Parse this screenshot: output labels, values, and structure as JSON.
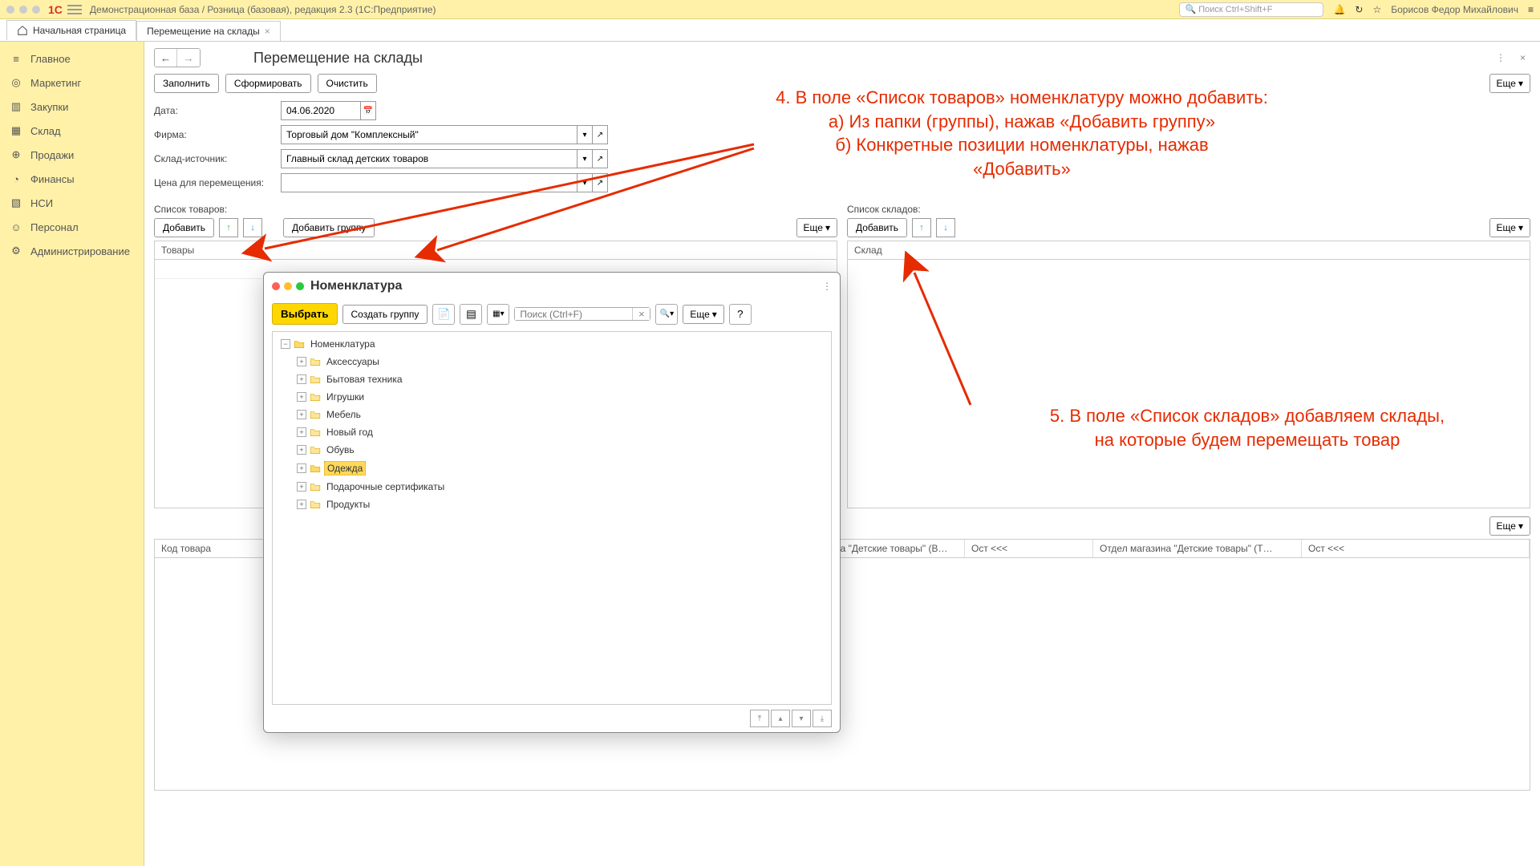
{
  "titlebar": {
    "app_title": "Демонстрационная база / Розница (базовая), редакция 2.3  (1С:Предприятие)",
    "search_placeholder": "Поиск Ctrl+Shift+F",
    "username": "Борисов Федор Михайлович"
  },
  "tabs": {
    "home": "Начальная страница",
    "active": "Перемещение на склады"
  },
  "sidebar": {
    "items": [
      {
        "label": "Главное",
        "icon": "≡"
      },
      {
        "label": "Маркетинг",
        "icon": "◎"
      },
      {
        "label": "Закупки",
        "icon": "▥"
      },
      {
        "label": "Склад",
        "icon": "▦"
      },
      {
        "label": "Продажи",
        "icon": "⊕"
      },
      {
        "label": "Финансы",
        "icon": "◔"
      },
      {
        "label": "НСИ",
        "icon": "▧"
      },
      {
        "label": "Персонал",
        "icon": "☺"
      },
      {
        "label": "Администрирование",
        "icon": "⚙"
      }
    ]
  },
  "page": {
    "title": "Перемещение на склады",
    "btn_fill": "Заполнить",
    "btn_form": "Сформировать",
    "btn_clear": "Очистить",
    "btn_more": "Еще",
    "more_caret": "▾"
  },
  "form": {
    "date_label": "Дата:",
    "date_value": "04.06.2020",
    "firm_label": "Фирма:",
    "firm_value": "Торговый дом \"Комплексный\"",
    "source_label": "Склад-источник:",
    "source_value": "Главный склад детских товаров",
    "price_label": "Цена для перемещения:",
    "price_value": ""
  },
  "goods": {
    "list_label": "Список товаров:",
    "btn_add": "Добавить",
    "btn_add_group": "Добавить группу",
    "header": "Товары"
  },
  "warehouses": {
    "list_label": "Список складов:",
    "btn_add": "Добавить",
    "header": "Склад"
  },
  "bottom": {
    "col_code": "Код товара",
    "col_ost1_prefix": "на \"Детские товары\" (В…",
    "col_ost1": "Ост <<<",
    "col_dept": "Отдел магазина \"Детские товары\" (Т…",
    "col_ost2": "Ост <<<"
  },
  "dialog": {
    "title": "Номенклатура",
    "btn_select": "Выбрать",
    "btn_create_group": "Создать группу",
    "search_placeholder": "Поиск (Ctrl+F)",
    "btn_more": "Еще",
    "btn_help": "?",
    "tree": {
      "root": "Номенклатура",
      "children": [
        "Аксессуары",
        "Бытовая техника",
        "Игрушки",
        "Мебель",
        "Новый год",
        "Обувь",
        "Одежда",
        "Подарочные сертификаты",
        "Продукты"
      ],
      "selected_index": 6
    }
  },
  "annotations": {
    "note4_line1": "4. В поле «Список товаров» номенклатуру можно добавить:",
    "note4_line2": "а) Из папки (группы), нажав «Добавить группу»",
    "note4_line3": "б) Конкретные позиции номенклатуры, нажав",
    "note4_line4": "«Добавить»",
    "note5_line1": "5. В поле «Список складов» добавляем склады,",
    "note5_line2": " на которые будем перемещать товар"
  },
  "colors": {
    "accent_red": "#e62b00",
    "highlight_yellow": "#ffd85c",
    "sidebar_bg": "#FFF1A8"
  }
}
